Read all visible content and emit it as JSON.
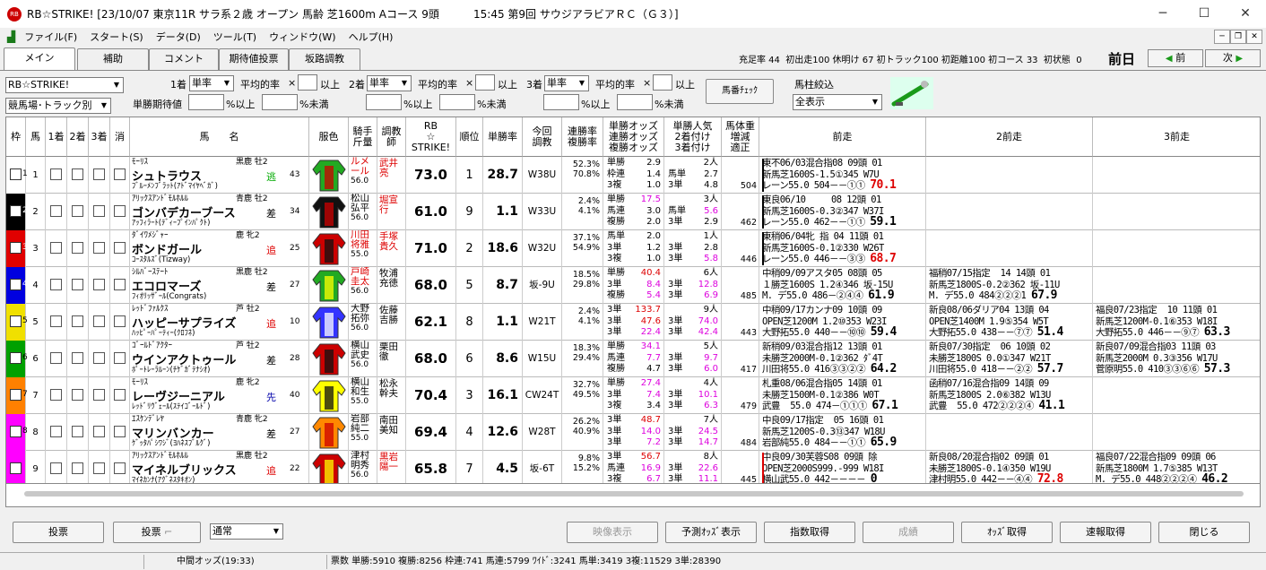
{
  "window": {
    "title": "RB☆STRIKE! [23/10/07 東京11R サラ系２歳 オープン 馬齢 芝1600m Aコース 9頭          15:45 第9回 サウジアラビアＲＣ（Ｇ３）]"
  },
  "menu": [
    "ファイル(F)",
    "スタート(S)",
    "データ(D)",
    "ツール(T)",
    "ウィンドウ(W)",
    "ヘルプ(H)"
  ],
  "tabs": [
    "メイン",
    "補助",
    "コメント",
    "期待値投票",
    "坂路調教"
  ],
  "stats": "充足率 44  初出走100 休明け 67 初トラック100 初距離100 初コース 33  初状態  0",
  "day_label": "前日",
  "nav": {
    "prev": "前",
    "next": "次"
  },
  "filters": {
    "program": "RB☆STRIKE!",
    "track": "競馬場･トラック別",
    "first_label": "1着",
    "second_label": "2着",
    "third_label": "3着",
    "bet_type": "単率",
    "avg_label": "平均的率",
    "times": "×",
    "above": "以上",
    "expect_label": "単勝期待値",
    "pct_above": "%以上",
    "pct_below": "%未満",
    "horse_check": "馬番ﾁｪｯｸ",
    "horse_filter_label": "馬柱絞込",
    "horse_filter_value": "全表示"
  },
  "headers": {
    "waku": "枠",
    "uma": "馬",
    "c1": "1着",
    "c2": "2着",
    "c3": "3着",
    "kesu": "消",
    "name": "馬　　名",
    "silk": "服色",
    "jockey": "騎手\n斤量",
    "trainer": "調教\n師",
    "rb": "RB\n☆\nSTRIKE!",
    "rank": "順位",
    "win_rate": "単勝率",
    "course": "今回\n調教",
    "rates": "連勝率\n複勝率",
    "odds": "単勝オッズ\n連勝オッズ\n複勝オッズ",
    "pop": "単勝人気\n2着付け\n3着付け",
    "weight": "馬体重\n増減\n適正",
    "prev1": "前走",
    "prev2": "2前走",
    "prev3": "3前走"
  },
  "horses": [
    {
      "num": "1",
      "sire": "ﾓｰﾘｽ",
      "sex": "黒鹿 牡2",
      "name": "シュトラウス",
      "dam": "ﾌﾞﾙｰﾒﾝﾌﾞﾗｯﾄ(ｱﾄﾞﾏｲﾔﾍﾞｶﾞ)",
      "style": "逃",
      "styleColor": "#0a0",
      "wt": "43",
      "jockey": "ルメ\nール",
      "jockeyRed": true,
      "kin": "56.0",
      "trainer": "武井\n亮",
      "trainerRed": true,
      "rb": "73.0",
      "rank": "1",
      "win": "28.7",
      "course": "W38U",
      "r1": "52.3%",
      "r2": "70.8%",
      "odds": [
        [
          "単勝",
          "2.9"
        ],
        [
          "枠連",
          "1.4"
        ],
        [
          "3複",
          "1.0"
        ]
      ],
      "pop": [
        [
          "",
          "2人"
        ],
        [
          "馬単",
          "2.7"
        ],
        [
          "3単",
          "4.8"
        ]
      ],
      "bw": "504",
      "p1": "東不06/03混合指08 09頭 01\n新馬芝1600S-1.5①345 W7U\nレーン55.0 504－－①① ",
      "p1s": "70.1",
      "p1sColor": "#d00",
      "p2": "",
      "p3": ""
    },
    {
      "num": "2",
      "sire": "ｱﾘｯｸｽｱﾝﾄﾞﾓﾙﾎﾙﾙ",
      "sex": "青鹿 牡2",
      "name": "ゴンバデカーブース",
      "dam": "ｱｯﾌｨﾗｰﾄ(ﾃﾞｨｰﾌﾟｲﾝﾊﾟｸﾄ)",
      "style": "差",
      "styleColor": "#000",
      "wt": "34",
      "jockey": "松山\n弘平",
      "jockeyRed": false,
      "kin": "56.0",
      "trainer": "堀宣\n行",
      "trainerRed": true,
      "rb": "61.0",
      "rank": "9",
      "win": "1.1",
      "course": "W33U",
      "r1": "2.4%",
      "r2": "4.1%",
      "odds": [
        [
          "単勝",
          "17.5"
        ],
        [
          "馬連",
          "3.0"
        ],
        [
          "複勝",
          "2.0"
        ]
      ],
      "pop": [
        [
          "",
          "3人"
        ],
        [
          "馬単",
          "5.6"
        ],
        [
          "3単",
          "2.9"
        ]
      ],
      "bw": "462",
      "p1": "東良06/10     08 12頭 01\n新馬芝1600S-0.3②347 W37I\nレーン55.0 462－－①① ",
      "p1s": "59.1",
      "p1sColor": "#000",
      "p2": "",
      "p3": ""
    },
    {
      "num": "3",
      "sire": "ﾀﾞｲﾜﾒｼﾞｬｰ",
      "sex": "鹿 牝2",
      "name": "ボンドガール",
      "dam": "ｺｰｽﾀﾙｽﾞ(Tizway)",
      "style": "追",
      "styleColor": "#d00",
      "wt": "25",
      "jockey": "川田\n将雅",
      "jockeyRed": true,
      "kin": "55.0",
      "trainer": "手塚\n貴久",
      "trainerRed": true,
      "rb": "71.0",
      "rank": "2",
      "win": "18.6",
      "course": "W32U",
      "r1": "37.1%",
      "r2": "54.9%",
      "odds": [
        [
          "馬単",
          "2.0"
        ],
        [
          "3単",
          "1.2"
        ],
        [
          "3複",
          "1.0"
        ]
      ],
      "pop": [
        [
          "",
          "1人"
        ],
        [
          "3単",
          "2.8"
        ],
        [
          "3単",
          "5.8"
        ]
      ],
      "bw": "446",
      "p1": "東稍06/04牝 指 04 11頭 01\n新馬芝1600S-0.1②330 W26T\nレーン55.0 446－－③③ ",
      "p1s": "68.7",
      "p1sColor": "#d00",
      "p2": "",
      "p3": ""
    },
    {
      "num": "4",
      "sire": "ｼﾙﾊﾞｰｽﾃｰﾄ",
      "sex": "黒鹿 牡2",
      "name": "エコロマーズ",
      "dam": "ﾌｨｵﾘｯｻﾞｰﾙ(Congrats)",
      "style": "差",
      "styleColor": "#000",
      "wt": "27",
      "jockey": "戸崎\n圭太",
      "jockeyRed": true,
      "kin": "56.0",
      "trainer": "牧浦\n充徳",
      "trainerRed": false,
      "rb": "68.0",
      "rank": "5",
      "win": "8.7",
      "course": "坂-9U",
      "r1": "18.5%",
      "r2": "29.8%",
      "odds": [
        [
          "単勝",
          "40.4"
        ],
        [
          "3単",
          "8.4"
        ],
        [
          "複勝",
          "5.4"
        ]
      ],
      "pop": [
        [
          "",
          "6人"
        ],
        [
          "3単",
          "12.8"
        ],
        [
          "3単",
          "6.9"
        ]
      ],
      "bw": "485",
      "p1": "中稍09/09アスタ05 08頭 05\n１勝芝1600S 1.2④346 坂-15U\nM. デ55.0 486－②④④ ",
      "p1s": "61.9",
      "p1sColor": "#000",
      "p2": "福稍07/15指定  14 14頭 01\n新馬芝1800S-0.2②362 坂-11U\nM. デ55.0 484②②②1 ",
      "p2s": "67.9",
      "p3": ""
    },
    {
      "num": "5",
      "sire": "ﾚｯﾄﾞﾌｧﾙｸｽ",
      "sex": "芦 牡2",
      "name": "ハッピーサプライズ",
      "dam": "ﾊｯﾋﾟｰﾊﾟｰﾃｨｰ(ｸﾛﾌﾈ)",
      "style": "追",
      "styleColor": "#d00",
      "wt": "10",
      "jockey": "大野\n拓弥",
      "jockeyRed": false,
      "kin": "56.0",
      "trainer": "佐藤\n吉勝",
      "trainerRed": false,
      "rb": "62.1",
      "rank": "8",
      "win": "1.1",
      "course": "W21T",
      "r1": "2.4%",
      "r2": "4.1%",
      "odds": [
        [
          "3単",
          "133.7"
        ],
        [
          "3単",
          "47.6"
        ],
        [
          "3単",
          "22.4"
        ]
      ],
      "pop": [
        [
          "",
          "9人"
        ],
        [
          "3単",
          "74.0"
        ],
        [
          "3単",
          "42.4"
        ]
      ],
      "bw": "443",
      "p1": "中稍09/17カンナ09 10頭 09\nOPEN芝1200M 1.2⑩353 W23I\n大野拓55.0 440－－⑩⑩ ",
      "p1s": "59.4",
      "p1sColor": "#000",
      "p2": "新良08/06ダリア04 13頭 04\nOPEN芝1400M 1.9⑤354 W5T\n大野拓55.0 438－－⑦⑦ ",
      "p2s": "51.4",
      "p3": "福良07/23指定  10 11頭 01\n新馬芝1200M-0.1⑥353 W18I\n大野拓55.0 446－－⑨⑦ ",
      "p3s": "63.3"
    },
    {
      "num": "6",
      "sire": "ｺﾞｰﾙﾄﾞｱｸﾀｰ",
      "sex": "芦 牡2",
      "name": "ウインアクトゥール",
      "dam": "ﾎﾟｰﾄﾚｰﾗﾙｰﾝ(ﾁｹﾞｶﾞﾃﾅｼｵ)",
      "style": "差",
      "styleColor": "#000",
      "wt": "28",
      "jockey": "横山\n武史",
      "jockeyRed": false,
      "kin": "56.0",
      "trainer": "栗田\n徹",
      "trainerRed": false,
      "rb": "68.0",
      "rank": "6",
      "win": "8.6",
      "course": "W15U",
      "r1": "18.3%",
      "r2": "29.4%",
      "odds": [
        [
          "単勝",
          "34.1"
        ],
        [
          "馬連",
          "7.7"
        ],
        [
          "複勝",
          "4.7"
        ]
      ],
      "pop": [
        [
          "",
          "5人"
        ],
        [
          "3単",
          "9.7"
        ],
        [
          "3単",
          "6.0"
        ]
      ],
      "bw": "417",
      "p1": "新稍09/03混合指12 13頭 01\n未勝芝2000M-0.1②362 ﾀﾞ4T\n川田将55.0 416③③②② ",
      "p1s": "64.2",
      "p1sColor": "#000",
      "p2": "新良07/30指定  06 10頭 02\n未勝芝1800S 0.0①347 W21T\n川田将55.0 418－－②② ",
      "p2s": "57.7",
      "p3": "新良07/09混合指03 11頭 03\n新馬芝2000M 0.3③356 W17U\n菅原明55.0 410③③⑥⑥ ",
      "p3s": "57.3"
    },
    {
      "num": "7",
      "sire": "ﾓｰﾘｽ",
      "sex": "鹿 牝2",
      "name": "レーヴジーニアル",
      "dam": "ﾚｯﾄﾞﾘｳﾞｪｰﾙ(ｽﾃｲｺﾞｰﾙﾄﾞ)",
      "style": "先",
      "styleColor": "#00a",
      "wt": "40",
      "jockey": "横山\n和生",
      "jockeyRed": false,
      "kin": "55.0",
      "trainer": "松永\n幹夫",
      "trainerRed": false,
      "rb": "70.4",
      "rank": "3",
      "win": "16.1",
      "course": "CW24T",
      "r1": "32.7%",
      "r2": "49.5%",
      "odds": [
        [
          "単勝",
          "27.4"
        ],
        [
          "3単",
          "7.4"
        ],
        [
          "3複",
          "3.4"
        ]
      ],
      "pop": [
        [
          "",
          "4人"
        ],
        [
          "3単",
          "10.1"
        ],
        [
          "3単",
          "6.3"
        ]
      ],
      "bw": "479",
      "p1": "札重08/06混合指05 14頭 01\n未勝芝1500M-0.1②386 W0T\n武豊  55.0 474－①①① ",
      "p1s": "67.1",
      "p1sColor": "#000",
      "p2": "函稍07/16混合指09 14頭 09\n新馬芝1800S 2.0⑥382 W13U\n武豊  55.0 472②②②④ ",
      "p2s": "41.1",
      "p3": ""
    },
    {
      "num": "8",
      "sire": "ｴｽｹﾝﾃﾞﾚﾔ",
      "sex": "青鹿 牝2",
      "name": "マリンバンカー",
      "dam": "ｹﾞｯﾀﾊﾟｼﾜｼﾞ(ﾖﾊﾈｽﾌﾞﾙｸﾞ)",
      "style": "差",
      "styleColor": "#000",
      "wt": "27",
      "jockey": "岩部\n純二",
      "jockeyRed": false,
      "kin": "55.0",
      "trainer": "南田\n美知",
      "trainerRed": false,
      "rb": "69.4",
      "rank": "4",
      "win": "12.6",
      "course": "W28T",
      "r1": "26.2%",
      "r2": "40.9%",
      "odds": [
        [
          "3単",
          "48.7"
        ],
        [
          "3単",
          "14.0"
        ],
        [
          "3単",
          "7.2"
        ]
      ],
      "pop": [
        [
          "",
          "7人"
        ],
        [
          "3単",
          "24.5"
        ],
        [
          "3単",
          "14.7"
        ]
      ],
      "bw": "484",
      "p1": "中良09/17指定  05 16頭 01\n新馬芝1200S-0.3⑬347 W18U\n岩部純55.0 484－－①① ",
      "p1s": "65.9",
      "p1sColor": "#000",
      "p2": "",
      "p3": ""
    },
    {
      "num": "9",
      "sire": "ｱﾘｯｸｽｱﾝﾄﾞﾓﾙﾎﾙﾙ",
      "sex": "黒鹿 牡2",
      "name": "マイネルブリックス",
      "dam": "ﾏｲﾈｶﾝﾅ(ｱｸﾞﾈｽﾀｷｵﾝ)",
      "style": "追",
      "styleColor": "#d00",
      "wt": "22",
      "jockey": "津村\n明秀",
      "jockeyRed": false,
      "kin": "56.0",
      "trainer": "黒岩\n陽一",
      "trainerRed": true,
      "rb": "65.8",
      "rank": "7",
      "win": "4.5",
      "course": "坂-6T",
      "r1": "9.8%",
      "r2": "15.2%",
      "odds": [
        [
          "3単",
          "56.7"
        ],
        [
          "馬連",
          "16.9"
        ],
        [
          "3複",
          "6.7"
        ]
      ],
      "pop": [
        [
          "",
          "8人"
        ],
        [
          "3単",
          "22.6"
        ],
        [
          "3単",
          "11.1"
        ]
      ],
      "bw": "445",
      "p1": "中良09/30芙蓉S08 09頭 除\nOPEN芝2000S999.-999 W18I\n横山武55.0 442－－－－ ",
      "p1s": "0",
      "p1sColor": "#000",
      "p2": "新良08/20混合指02 09頭 01\n未勝芝1800S-0.1④350 W19U\n津村明55.0 442－－④④ ",
      "p2s": "72.8",
      "p2sColor": "#d00",
      "p3": "福良07/22混合指09 09頭 06\n新馬芝1800M 1.7⑤385 W13T\nM. デ55.0 448②②②④ ",
      "p3s": "46.2"
    }
  ],
  "waku_colors": [
    "#ffffff",
    "#000000",
    "#e00000",
    "#0000e0",
    "#f0e000",
    "#00a000",
    "#ff8000",
    "#ff00ff",
    "#ff00ff"
  ],
  "bottom": {
    "vote": "投票",
    "vote2": "投票",
    "mode": "通常",
    "video": "映像表示",
    "pred": "予測ｵｯｽﾞ表示",
    "index": "指数取得",
    "result": "成績",
    "odds": "ｵｯｽﾞ取得",
    "flash": "速報取得",
    "close": "閉じる"
  },
  "status": {
    "odds_time": "中間オッズ(19:33)",
    "votes": "票数 単勝:5910 複勝:8256 枠連:741 馬連:5799 ﾜｲﾄﾞ:3241 馬単:3419 3複:11529 3単:28390"
  }
}
